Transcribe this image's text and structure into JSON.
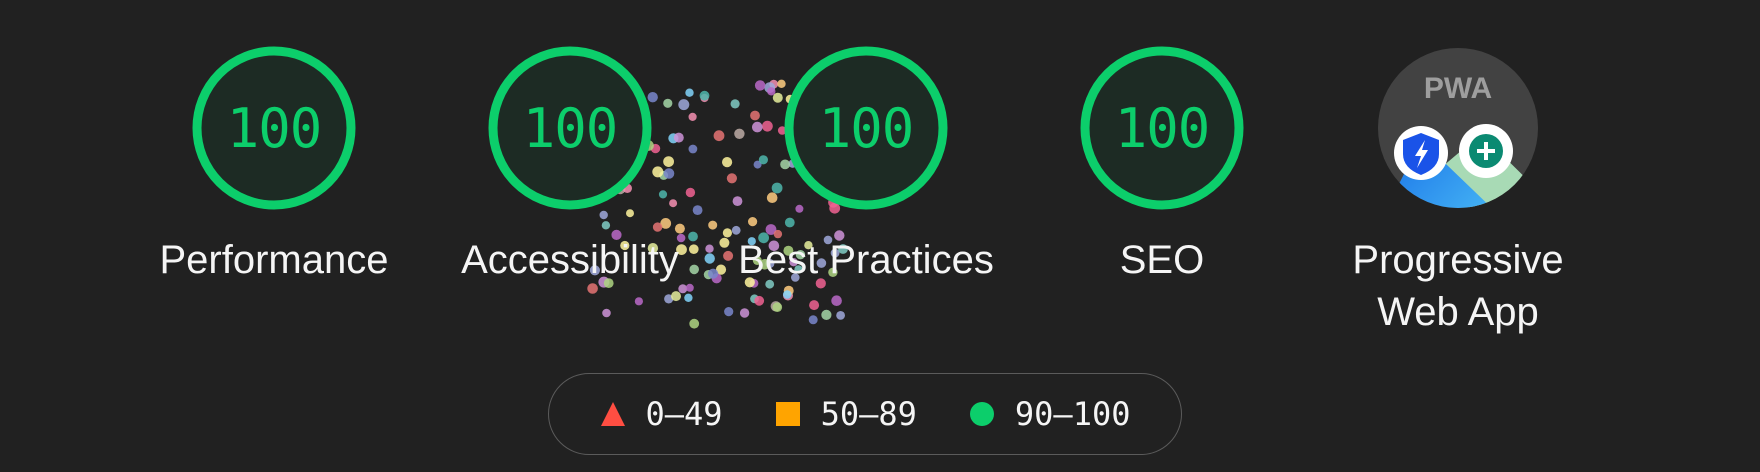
{
  "categories": [
    {
      "score": "100",
      "label": "Performance",
      "color": "#0cce6b"
    },
    {
      "score": "100",
      "label": "Accessibility",
      "color": "#0cce6b"
    },
    {
      "score": "100",
      "label": "Best Practices",
      "color": "#0cce6b"
    },
    {
      "score": "100",
      "label": "SEO",
      "color": "#0cce6b"
    }
  ],
  "pwa": {
    "badge_text": "PWA",
    "label": "Progressive Web App",
    "icons": [
      "fast-reliable-icon",
      "installable-icon"
    ]
  },
  "legend": [
    {
      "range": "0–49",
      "shape": "triangle",
      "color": "#ff4e42"
    },
    {
      "range": "50–89",
      "shape": "square",
      "color": "#ffa400"
    },
    {
      "range": "90–100",
      "shape": "circle",
      "color": "#0cce6b"
    }
  ],
  "colors": {
    "background": "#212121",
    "pass": "#0cce6b",
    "gauge_fill": "#1d2b24"
  }
}
